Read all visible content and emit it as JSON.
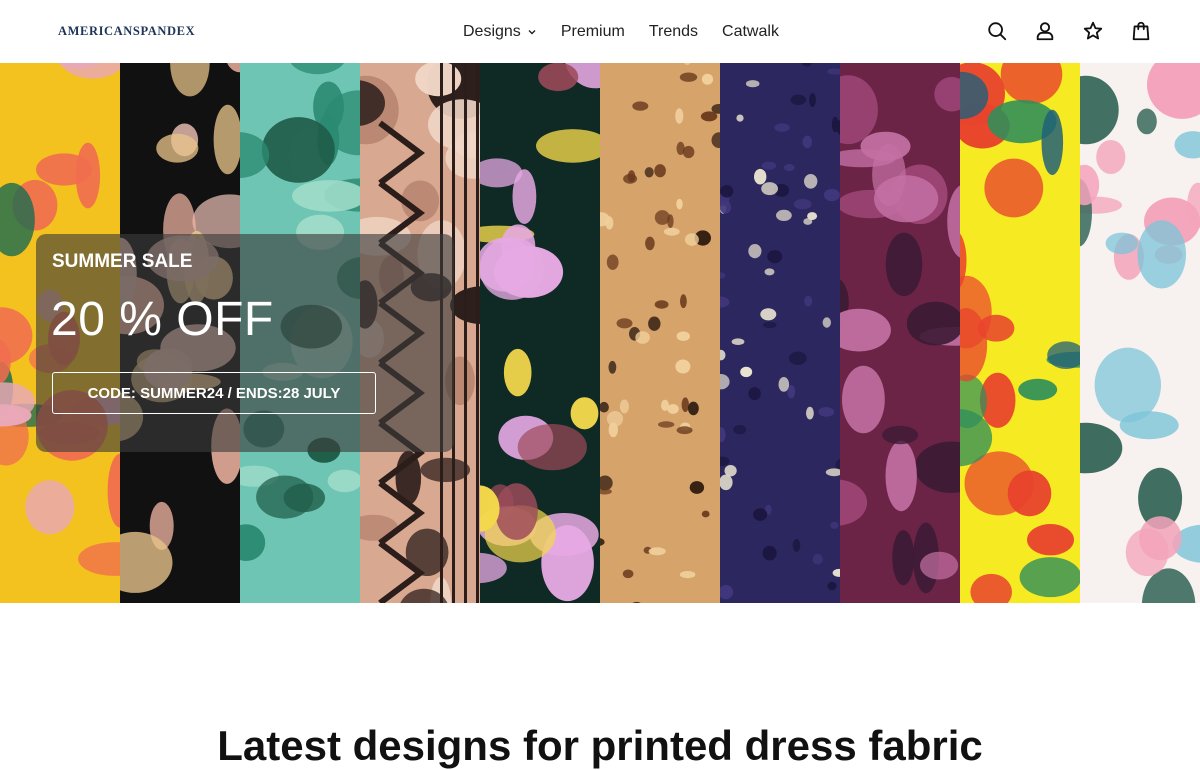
{
  "brand": {
    "logo_text": "AMERICANSPANDEX"
  },
  "nav": {
    "items": [
      {
        "label": "Designs",
        "has_dropdown": true
      },
      {
        "label": "Premium"
      },
      {
        "label": "Trends"
      },
      {
        "label": "Catwalk"
      }
    ]
  },
  "header_icons": [
    "search-icon",
    "account-icon",
    "wishlist-star-icon",
    "cart-bag-icon"
  ],
  "hero": {
    "fabric_strips": [
      {
        "pattern": "abstract-tropical",
        "colors": [
          "#f3c21f",
          "#1e6b4f",
          "#e9a8b8",
          "#f06d4f"
        ]
      },
      {
        "pattern": "abstract-swirl",
        "colors": [
          "#111111",
          "#f2b6a2",
          "#e8c48a",
          "#e3b9ae"
        ]
      },
      {
        "pattern": "eucalyptus-leaves",
        "colors": [
          "#6fc5b3",
          "#2b8a72",
          "#1f5e4a",
          "#9fdcc9"
        ]
      },
      {
        "pattern": "tribal-geometric",
        "colors": [
          "#d9a890",
          "#2a1d1a",
          "#f0d6c6",
          "#b98671"
        ]
      },
      {
        "pattern": "floral-dark",
        "colors": [
          "#0f2a24",
          "#e6a9e3",
          "#f3d84c",
          "#9e4a5a"
        ]
      },
      {
        "pattern": "leopard",
        "colors": [
          "#d6a36b",
          "#6a3a1d",
          "#f0cf9c",
          "#2d1a0f"
        ]
      },
      {
        "pattern": "dotted-indigo",
        "colors": [
          "#2d2760",
          "#e8e2d0",
          "#41377c",
          "#1b1740"
        ]
      },
      {
        "pattern": "purple-camo",
        "colors": [
          "#6b2446",
          "#a3497c",
          "#3a1a35",
          "#c470a4"
        ]
      },
      {
        "pattern": "yellow-tropical",
        "colors": [
          "#f6ea23",
          "#2f8f5a",
          "#e8432d",
          "#1f5f7a"
        ]
      },
      {
        "pattern": "watercolor-floral",
        "colors": [
          "#f7f2f0",
          "#f4a3bb",
          "#7cc4d8",
          "#3a6a5c"
        ]
      }
    ],
    "promo": {
      "eyebrow": "SUMMER SALE",
      "headline": "20 % OFF",
      "code_button": "CODE: SUMMER24 / ENDS:28 JULY"
    }
  },
  "section": {
    "heading": "Latest designs for printed dress fabric"
  }
}
